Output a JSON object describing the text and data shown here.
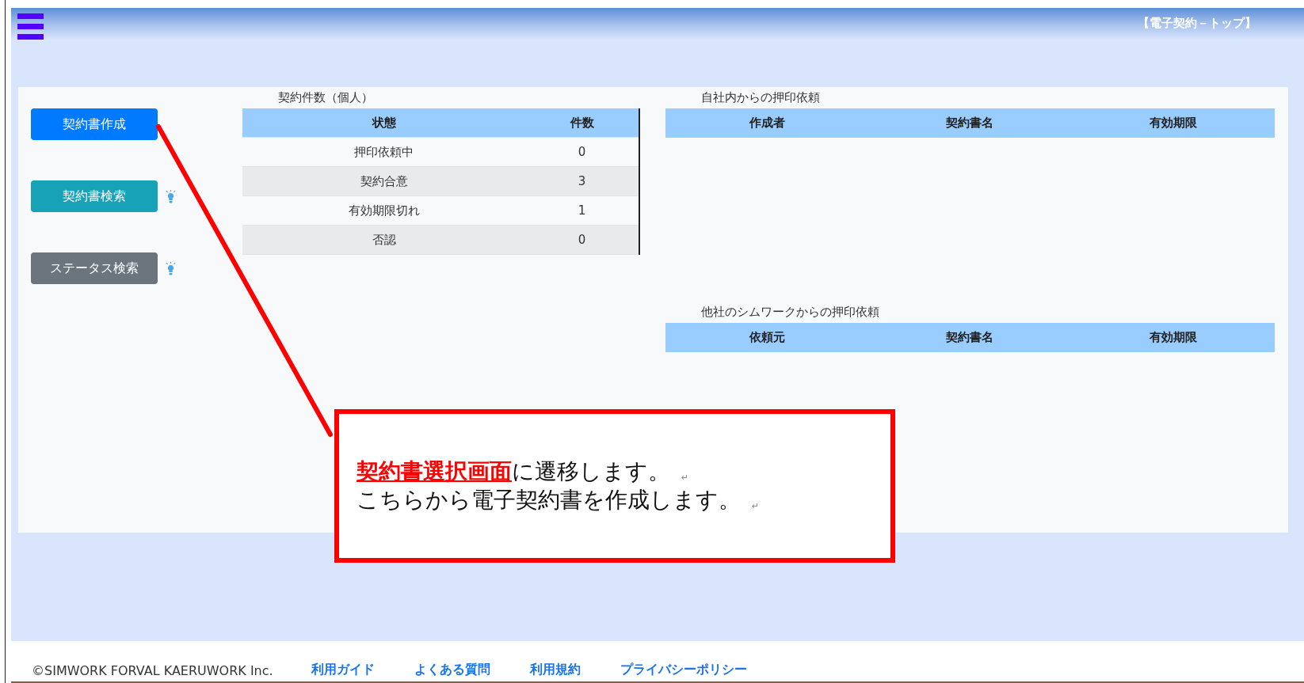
{
  "header": {
    "title": "【電子契約－トップ】"
  },
  "buttons": [
    {
      "label": "契約書作成",
      "kind": "primary",
      "has_hint": false
    },
    {
      "label": "契約書検索",
      "kind": "info",
      "has_hint": true
    },
    {
      "label": "ステータス検索",
      "kind": "secondary",
      "has_hint": true
    }
  ],
  "contract_counts": {
    "title": "契約件数（個人）",
    "columns": [
      "状態",
      "件数"
    ],
    "rows": [
      [
        "押印依頼中",
        "0"
      ],
      [
        "契約合意",
        "3"
      ],
      [
        "有効期限切れ",
        "1"
      ],
      [
        "否認",
        "0"
      ]
    ]
  },
  "internal_requests": {
    "title": "自社内からの押印依頼",
    "columns": [
      "作成者",
      "契約書名",
      "有効期限"
    ]
  },
  "external_requests": {
    "title": "他社のシムワークからの押印依頼",
    "columns": [
      "依頼元",
      "契約書名",
      "有効期限"
    ]
  },
  "callout": {
    "lines": [
      {
        "text": "**契約書選択画面**に遷移します。",
        "mark": "↵"
      },
      {
        "text": "こちらから電子契約書を作成します。",
        "mark": "↵"
      }
    ]
  },
  "footer": {
    "copyright": "©SIMWORK FORVAL KAERUWORK Inc.",
    "links": [
      "利用ガイド",
      "よくある質問",
      "利用規約",
      "プライバシーポリシー"
    ]
  }
}
